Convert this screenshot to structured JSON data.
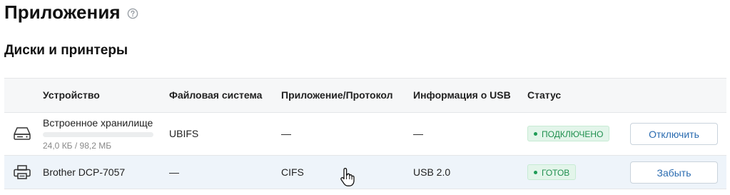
{
  "page": {
    "title": "Приложения",
    "help_icon": "question-circle-icon"
  },
  "section": {
    "title": "Диски и принтеры"
  },
  "table": {
    "columns": [
      "Устройство",
      "Файловая система",
      "Приложение/Протокол",
      "Информация о USB",
      "Статус"
    ],
    "rows": [
      {
        "icon": "hard-drive-icon",
        "device": "Встроенное хранилище",
        "storage_usage": "24,0 КБ / 98,2 МБ",
        "storage_fraction": 0.0002,
        "filesystem": "UBIFS",
        "protocol": "—",
        "usb": "—",
        "status": "ПОДКЛЮЧЕНО",
        "action": "Отключить"
      },
      {
        "icon": "printer-icon",
        "device": "Brother DCP-7057",
        "filesystem": "—",
        "protocol": "CIFS",
        "usb": "USB 2.0",
        "status": "ГОТОВ",
        "action": "Забыть"
      }
    ]
  },
  "colors": {
    "accent": "#2a6bb0",
    "status_ok_text": "#1f8f4e",
    "status_ok_bg": "#e3f5ea",
    "hover_row_bg": "#eef4fa"
  }
}
